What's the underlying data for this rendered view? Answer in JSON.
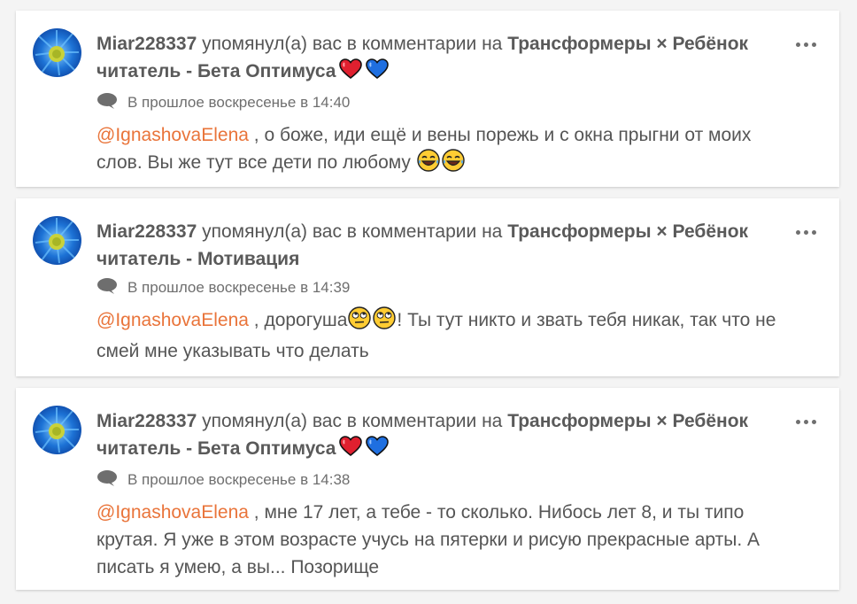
{
  "notifications": [
    {
      "username": "Miar228337",
      "action_text": " упомянул(а) вас в комментарии на ",
      "story_title": "Трансформеры × Ребёнок читатель - Бета Оптимуса",
      "title_icons": [
        "red-heart",
        "blue-heart"
      ],
      "timestamp": "В прошлое воскресенье в 14:40",
      "mention": "@IgnashovaElena",
      "comment_text": " , о боже, иди ещё и вены порежь и с окна прыгни от моих слов. Вы же тут все дети по любому ",
      "comment_icons": [
        "tears-of-joy-emoji",
        "tears-of-joy-emoji"
      ],
      "comment_tail": ""
    },
    {
      "username": "Miar228337",
      "action_text": " упомянул(а) вас в комментарии на ",
      "story_title": "Трансформеры × Ребёнок читатель - Мотивация",
      "title_icons": [],
      "timestamp": "В прошлое воскресенье в 14:39",
      "mention": "@IgnashovaElena",
      "comment_text": " , дорогуша",
      "comment_icons": [
        "eye-roll-emoji",
        "eye-roll-emoji"
      ],
      "comment_tail": "! Ты тут никто и звать тебя никак, так что не смей мне указывать что делать"
    },
    {
      "username": "Miar228337",
      "action_text": " упомянул(а) вас в комментарии на ",
      "story_title": "Трансформеры × Ребёнок читатель - Бета Оптимуса",
      "title_icons": [
        "red-heart",
        "blue-heart"
      ],
      "timestamp": "В прошлое воскресенье в 14:38",
      "mention": "@IgnashovaElena",
      "comment_text": " , мне 17 лет, а тебе - то сколько. Нибось лет 8, и ты типо крутая. Я уже в этом возрасте учусь на пятерки и рисую прекрасные арты. А писать я умею, а вы... Позорище",
      "comment_icons": [],
      "comment_tail": ""
    }
  ],
  "colors": {
    "mention": "#e9743a",
    "text": "#555555",
    "card": "#ffffff",
    "background": "#f4f4f4"
  }
}
